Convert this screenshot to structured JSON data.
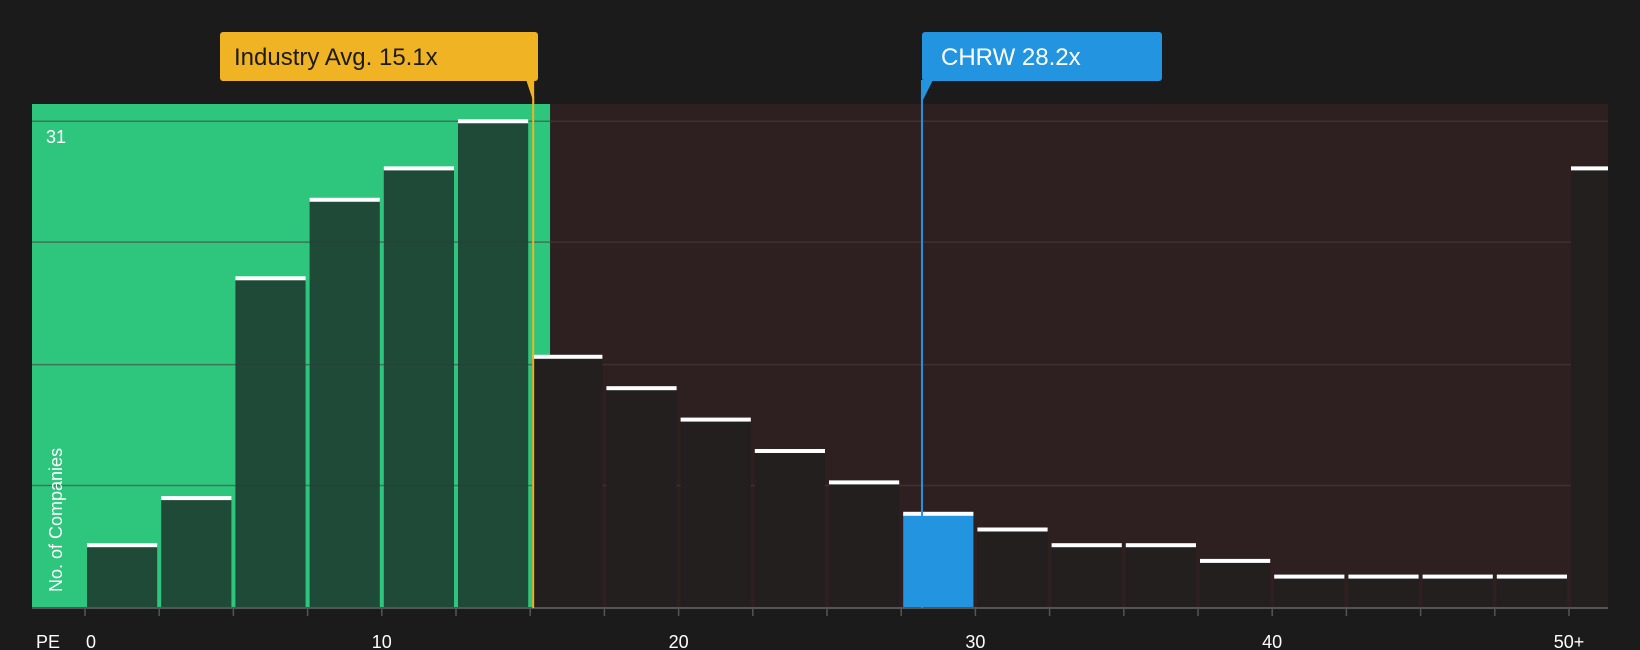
{
  "chart_data": {
    "type": "bar",
    "x_axis_label": "PE",
    "y_axis_label": "No. of Companies",
    "y_max_label": "31",
    "ylim": [
      0,
      32.1
    ],
    "x_ticks": [
      "0",
      "10",
      "20",
      "30",
      "40",
      "50+"
    ],
    "grid": true,
    "bins": [
      {
        "start": 0,
        "end": 2.5,
        "value": 4
      },
      {
        "start": 2.5,
        "end": 5,
        "value": 7
      },
      {
        "start": 5,
        "end": 7.5,
        "value": 21
      },
      {
        "start": 7.5,
        "end": 10,
        "value": 26
      },
      {
        "start": 10,
        "end": 12.5,
        "value": 28
      },
      {
        "start": 12.5,
        "end": 15,
        "value": 31
      },
      {
        "start": 15,
        "end": 17.5,
        "value": 16
      },
      {
        "start": 17.5,
        "end": 20,
        "value": 14
      },
      {
        "start": 20,
        "end": 22.5,
        "value": 12
      },
      {
        "start": 22.5,
        "end": 25,
        "value": 10
      },
      {
        "start": 25,
        "end": 27.5,
        "value": 8
      },
      {
        "start": 27.5,
        "end": 30,
        "value": 6
      },
      {
        "start": 30,
        "end": 32.5,
        "value": 5
      },
      {
        "start": 32.5,
        "end": 35,
        "value": 4
      },
      {
        "start": 35,
        "end": 37.5,
        "value": 4
      },
      {
        "start": 37.5,
        "end": 40,
        "value": 3
      },
      {
        "start": 40,
        "end": 42.5,
        "value": 2
      },
      {
        "start": 42.5,
        "end": 45,
        "value": 2
      },
      {
        "start": 45,
        "end": 47.5,
        "value": 2
      },
      {
        "start": 47.5,
        "end": 50,
        "value": 2
      },
      {
        "start": 50,
        "end": null,
        "value": 28,
        "label": "50+"
      }
    ],
    "industry_avg": {
      "label": "Industry Avg. 15.1x",
      "value": 15.1
    },
    "company": {
      "label": "CHRW 28.2x",
      "value": 28.2,
      "ticker": "CHRW"
    },
    "colors": {
      "background": "#1b1b1b",
      "below_avg_region": "#2ec67d",
      "above_avg_region": "#2e1f20",
      "bar_in_green": "#1f3f32",
      "bar_in_dark": "#231f1f",
      "bar_cap": "#ffffff",
      "industry_callout": "#f0b323",
      "company_color": "#2394e0",
      "gridline": "#4a3e3e",
      "axis": "#555555"
    }
  }
}
